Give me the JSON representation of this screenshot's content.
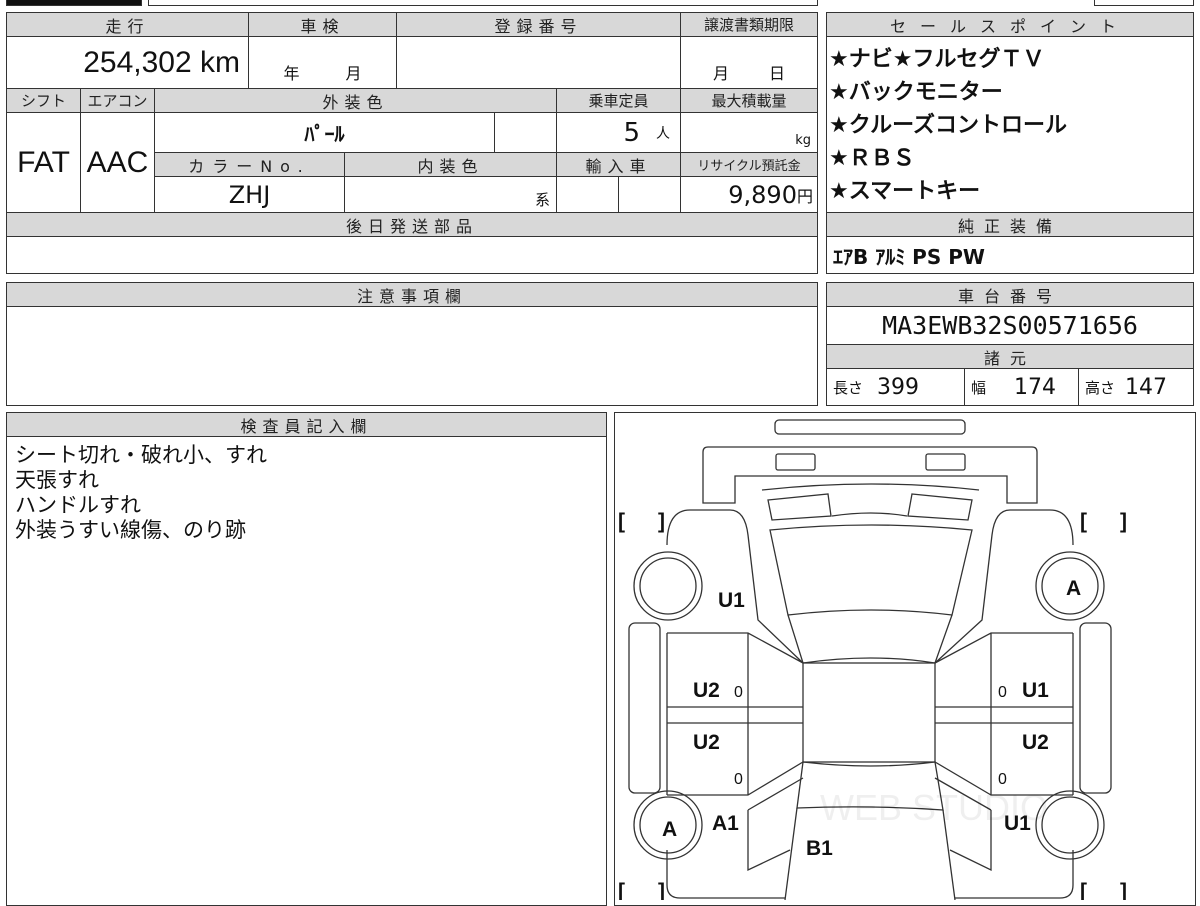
{
  "sheet": {
    "mileage": {
      "label": "走行",
      "value": "254,302 km"
    },
    "inspection": {
      "label": "車検",
      "year": "年",
      "month": "月"
    },
    "registration": {
      "label": "登録番号",
      "value": ""
    },
    "transfer_deadline": {
      "label": "譲渡書類期限",
      "month": "月",
      "day": "日"
    },
    "shift": {
      "label": "シフト",
      "value": "FAT"
    },
    "aircon": {
      "label": "エアコン",
      "value": "AAC"
    },
    "exterior_color": {
      "label": "外装色",
      "value": "ﾊﾟｰﾙ"
    },
    "capacity": {
      "label": "乗車定員",
      "value": "5",
      "unit": "人"
    },
    "max_load": {
      "label": "最大積載量",
      "unit": "kg"
    },
    "color_no": {
      "label": "カラーNo.",
      "value": "ZHJ"
    },
    "interior_color": {
      "label": "内装色",
      "unit": "系"
    },
    "import": {
      "label": "輸入車"
    },
    "recycle": {
      "label": "リサイクル預託金",
      "value": "9,890",
      "unit": "円"
    },
    "later_parts": {
      "label": "後日発送部品"
    },
    "notes": {
      "label": "注意事項欄"
    }
  },
  "sales_points": {
    "label": "セールスポイント",
    "items": [
      "★ナビ★フルセグＴＶ",
      "★バックモニター",
      "★クルーズコントロール",
      "★ＲＢＳ",
      "★スマートキー"
    ]
  },
  "equipment": {
    "label": "純正装備",
    "value": "ｴｱB ｱﾙﾐ PS PW"
  },
  "chassis": {
    "label": "車台番号",
    "value": "MA3EWB32S00571656"
  },
  "specs": {
    "label": "諸元",
    "length": {
      "label": "長さ",
      "value": "399"
    },
    "width": {
      "label": "幅",
      "value": "174"
    },
    "height": {
      "label": "高さ",
      "value": "147"
    }
  },
  "inspector": {
    "label": "検査員記入欄",
    "lines": [
      "シート切れ・破れ小、すれ",
      "天張すれ",
      "ハンドルすれ",
      "外装うすい線傷、のり跡"
    ]
  },
  "diagram": {
    "marks": [
      "U1",
      "A",
      "U2",
      "0",
      "0",
      "U1",
      "U2",
      "U2",
      "0",
      "0",
      "A1",
      "A",
      "U1",
      "B1"
    ],
    "bracket_open": "[",
    "bracket_close": "]",
    "watermark": "WEB STUDIO"
  }
}
